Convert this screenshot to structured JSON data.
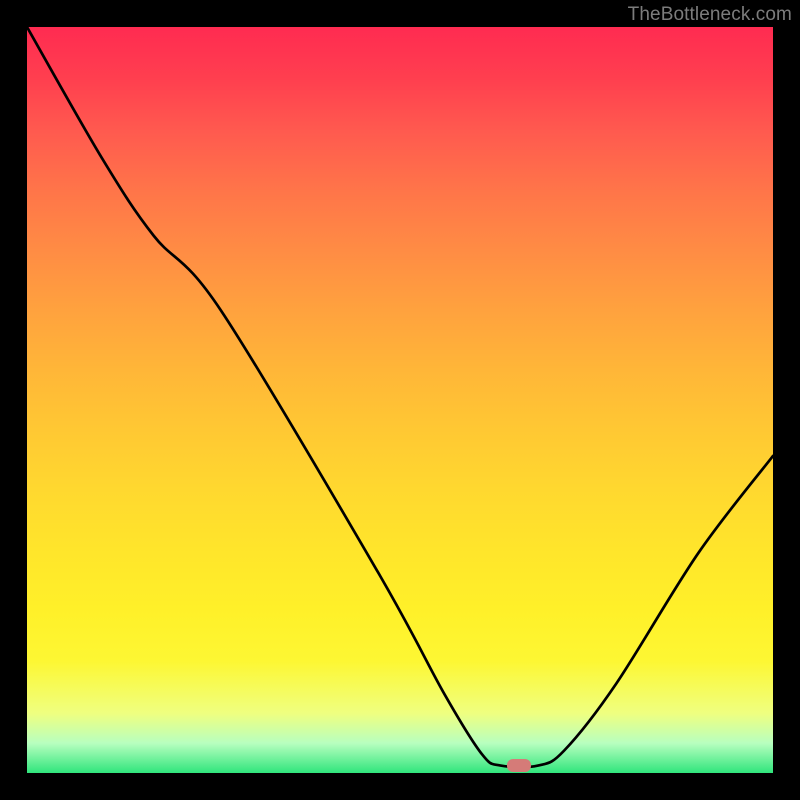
{
  "watermark": "TheBottleneck.com",
  "marker": {
    "cx_frac": 0.66,
    "cy_frac": 0.99
  },
  "chart_data": {
    "type": "line",
    "title": "",
    "xlabel": "",
    "ylabel": "",
    "xlim": [
      0,
      1
    ],
    "ylim": [
      0,
      1
    ],
    "series": [
      {
        "name": "bottleneck-curve",
        "points": [
          {
            "x": 0.0,
            "y": 1.0
          },
          {
            "x": 0.1,
            "y": 0.825
          },
          {
            "x": 0.17,
            "y": 0.72
          },
          {
            "x": 0.26,
            "y": 0.62
          },
          {
            "x": 0.47,
            "y": 0.27
          },
          {
            "x": 0.56,
            "y": 0.105
          },
          {
            "x": 0.61,
            "y": 0.025
          },
          {
            "x": 0.635,
            "y": 0.01
          },
          {
            "x": 0.685,
            "y": 0.01
          },
          {
            "x": 0.72,
            "y": 0.03
          },
          {
            "x": 0.79,
            "y": 0.12
          },
          {
            "x": 0.9,
            "y": 0.295
          },
          {
            "x": 1.0,
            "y": 0.425
          }
        ]
      }
    ],
    "marker": {
      "x": 0.66,
      "y": 0.01,
      "color": "#d57b78"
    },
    "background_gradient": {
      "top": "#ff2b51",
      "bottom": "#30e57c"
    }
  }
}
